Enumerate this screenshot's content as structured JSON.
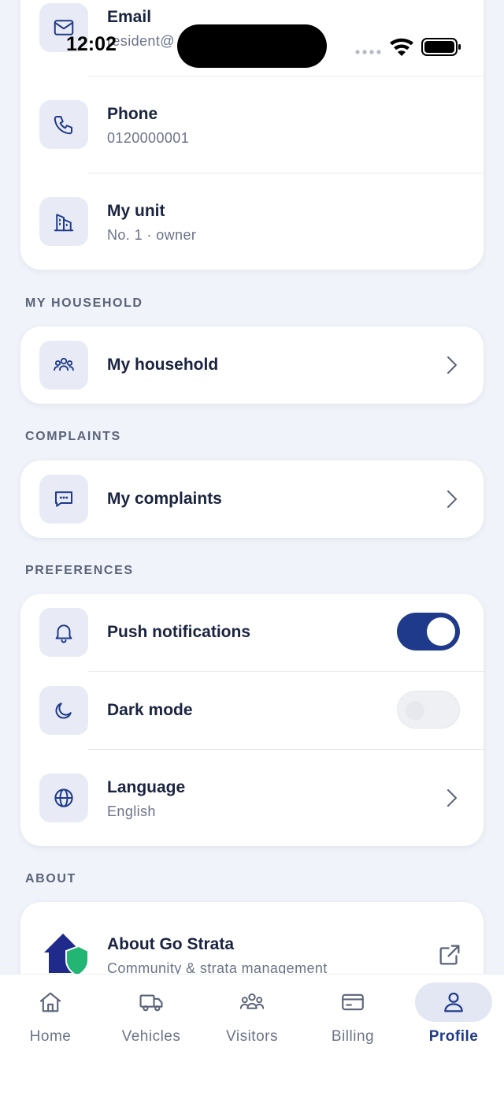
{
  "status_bar": {
    "time": "12:02"
  },
  "contact": {
    "email": {
      "title": "Email",
      "value": "resident@"
    },
    "phone": {
      "title": "Phone",
      "value": "0120000001"
    },
    "unit": {
      "title": "My unit",
      "value": "No. 1 · owner"
    }
  },
  "sections": {
    "household": "MY HOUSEHOLD",
    "complaints": "COMPLAINTS",
    "preferences": "PREFERENCES",
    "about": "ABOUT"
  },
  "household": {
    "label": "My household"
  },
  "complaints": {
    "label": "My complaints"
  },
  "preferences": {
    "push": {
      "label": "Push notifications",
      "enabled": true
    },
    "dark": {
      "label": "Dark mode",
      "enabled": false
    },
    "language": {
      "label": "Language",
      "value": "English"
    }
  },
  "about": {
    "title": "About Go Strata",
    "subtitle": "Community & strata management"
  },
  "colors": {
    "accent": "#1f3a8a",
    "background": "#f1f3fa",
    "logo_house": "#1f2a8a",
    "logo_shield": "#22b573"
  },
  "tabs": [
    {
      "label": "Home",
      "icon": "home-icon",
      "active": false
    },
    {
      "label": "Vehicles",
      "icon": "truck-icon",
      "active": false
    },
    {
      "label": "Visitors",
      "icon": "people-icon",
      "active": false
    },
    {
      "label": "Billing",
      "icon": "card-icon",
      "active": false
    },
    {
      "label": "Profile",
      "icon": "user-icon",
      "active": true
    }
  ]
}
